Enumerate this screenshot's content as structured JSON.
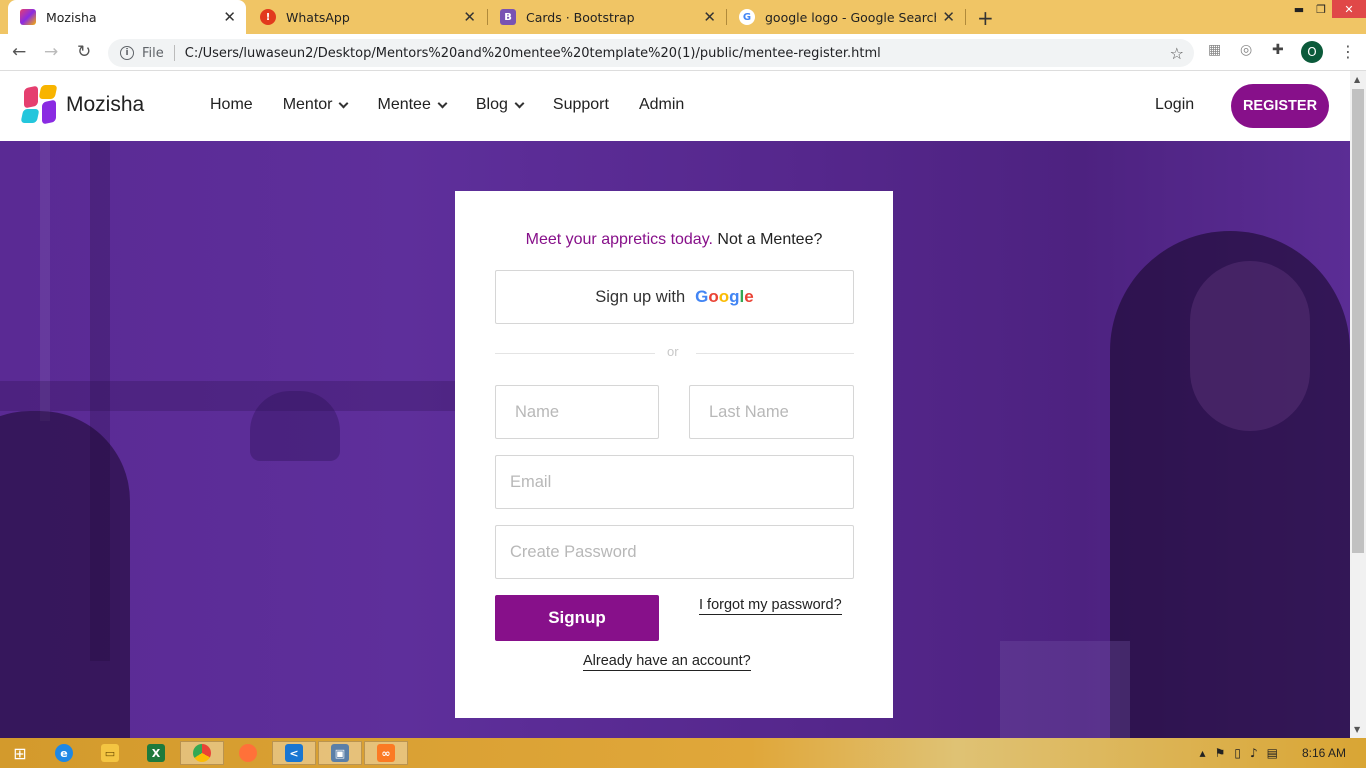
{
  "browser": {
    "tabs": [
      {
        "title": "Mozisha",
        "favicon_color": "#e53f6f",
        "active": true
      },
      {
        "title": "WhatsApp",
        "favicon_color": "#e23a1d",
        "favicon_glyph": "!",
        "active": false
      },
      {
        "title": "Cards · Bootstrap",
        "favicon_color": "#7952b3",
        "favicon_glyph": "B",
        "active": false
      },
      {
        "title": "google logo - Google Search",
        "favicon_color": "#ffffff",
        "favicon_glyph": "G",
        "active": false
      }
    ],
    "address": {
      "scheme": "File",
      "url": "C:/Users/luwaseun2/Desktop/Mentors%20and%20mentee%20template%20(1)/public/mentee-register.html"
    },
    "profile_initial": "O"
  },
  "site": {
    "brand": "Mozisha",
    "nav": [
      "Home",
      "Mentor",
      "Mentee",
      "Blog",
      "Support",
      "Admin"
    ],
    "login_label": "Login",
    "register_label": "REGISTER"
  },
  "form": {
    "headline_purple": "Meet your appretics today.",
    "headline_dark": " Not a Mentee?",
    "google_prefix": "Sign up with",
    "google_word": [
      "G",
      "o",
      "o",
      "g",
      "l",
      "e"
    ],
    "or_label": "or",
    "name_placeholder": "Name",
    "last_name_placeholder": "Last Name",
    "email_placeholder": "Email",
    "password_placeholder": "Create Password",
    "signup_label": "Signup",
    "forgot_label": "I forgot my password?",
    "already_label": "Already have an account?"
  },
  "colors": {
    "brand_purple": "#87108a",
    "hero_purple": "#5a2a94",
    "google_letters": [
      "#4285f4",
      "#ea4335",
      "#fbbc05",
      "#4285f4",
      "#34a853",
      "#ea4335"
    ]
  },
  "taskbar": {
    "clock": "8:16 AM"
  }
}
